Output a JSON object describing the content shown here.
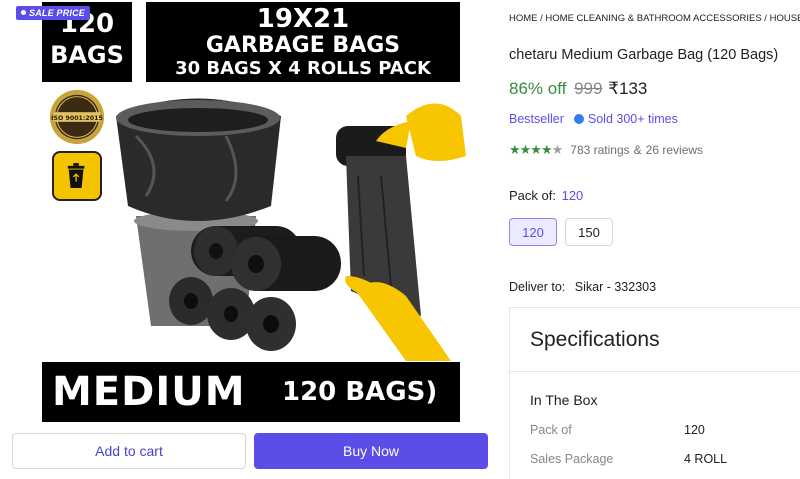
{
  "product_image": {
    "sale_badge": "SALE PRICE",
    "count_number": "120",
    "count_unit": "BAGS",
    "title_line1": "19X21",
    "title_line2": "GARBAGE BAGS",
    "title_line3": "30 BAGS X 4 ROLLS PACK",
    "iso_text": "ISO 9001:2015",
    "bottom_big": "MEDIUM",
    "bottom_small": "120 BAGS)"
  },
  "actions": {
    "add_to_cart": "Add to cart",
    "buy_now": "Buy Now"
  },
  "breadcrumb": "HOME / HOME CLEANING & BATHROOM ACCESSORIES / HOUSEHOLD",
  "product": {
    "title": "chetaru Medium Garbage Bag (120 Bags)",
    "discount": "86% off",
    "mrp": "999",
    "price": "₹133",
    "tag_bestseller": "Bestseller",
    "tag_sold": "Sold 300+ times",
    "rating_value": 4.5,
    "ratings_text": "783 ratings",
    "reviews_text": "26 reviews",
    "amp": "&"
  },
  "variants": {
    "label": "Pack of:",
    "selected": "120",
    "options": [
      "120",
      "150"
    ]
  },
  "delivery": {
    "label": "Deliver to:",
    "location": "Sikar - 332303"
  },
  "specifications": {
    "heading": "Specifications",
    "section": "In The Box",
    "rows": [
      {
        "key": "Pack of",
        "value": "120"
      },
      {
        "key": "Sales Package",
        "value": "4 ROLL"
      }
    ]
  },
  "colors": {
    "accent": "#5b4ee8",
    "discount_green": "#388e3c",
    "bin_yellow": "#f5c400",
    "glove_yellow": "#f7c600"
  }
}
